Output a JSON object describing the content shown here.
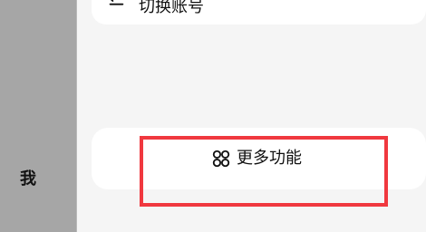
{
  "sidebar": {
    "me_label": "我"
  },
  "account": {
    "switch_label": "切换账号",
    "icon": "swap-icon"
  },
  "more_functions": {
    "label": "更多功能",
    "icon": "grid-four-circles-icon"
  },
  "annotation": {
    "highlight_color": "#f0383f"
  }
}
